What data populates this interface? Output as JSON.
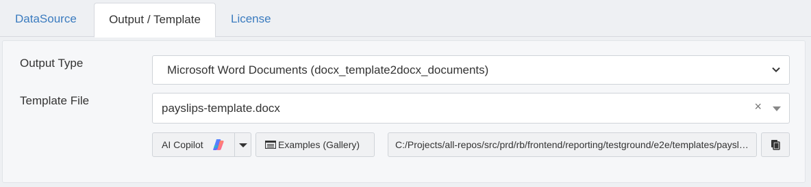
{
  "tabs": [
    {
      "label": "DataSource",
      "active": false
    },
    {
      "label": "Output / Template",
      "active": true
    },
    {
      "label": "License",
      "active": false
    }
  ],
  "output_type": {
    "label": "Output Type",
    "value": "Microsoft Word Documents (docx_template2docx_documents)"
  },
  "template_file": {
    "label": "Template File",
    "value": "payslips-template.docx",
    "clear_symbol": "×"
  },
  "toolbar": {
    "copilot_label": "AI Copilot",
    "examples_label": "Examples (Gallery)",
    "path_value": "C:/Projects/all-repos/src/prd/rb/frontend/reporting/testground/e2e/templates/payslips-template.docx"
  },
  "colors": {
    "link": "#3a7bbf",
    "panel_bg": "#f6f7f9"
  },
  "icons": [
    "chevron-down-icon",
    "clear-icon",
    "caret-down-icon",
    "copilot-icon",
    "gallery-icon",
    "copy-icon"
  ]
}
